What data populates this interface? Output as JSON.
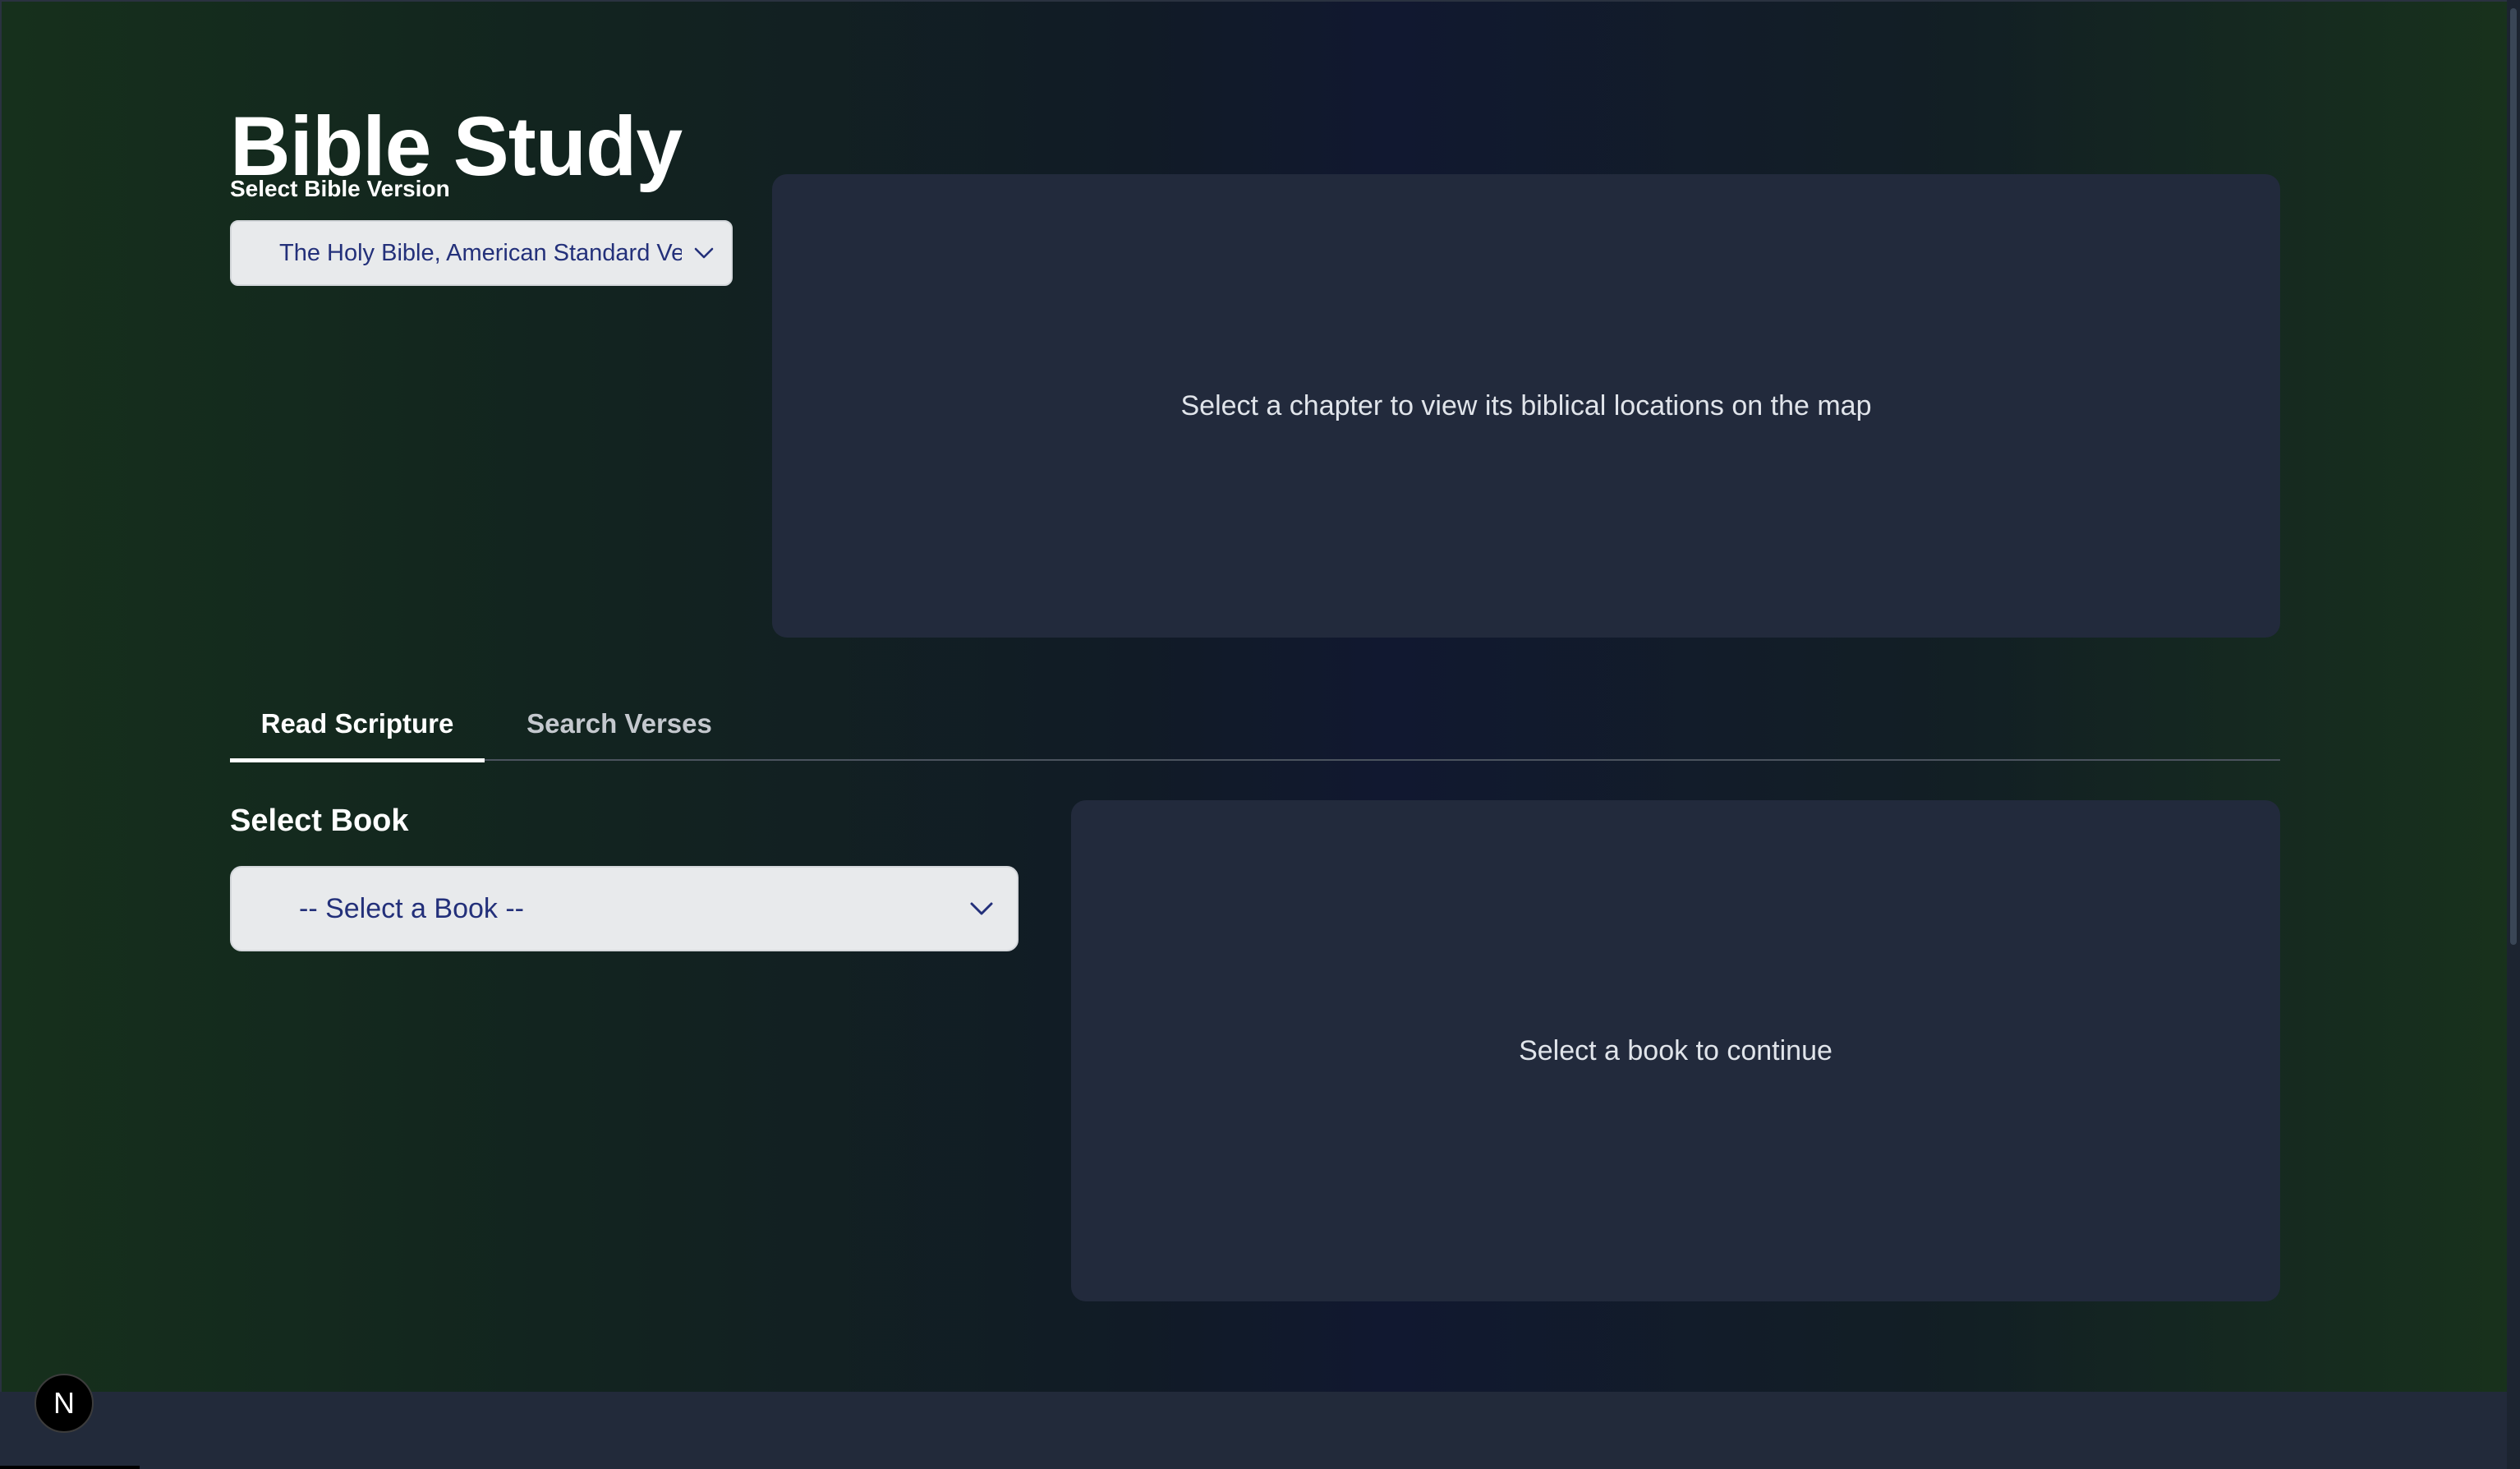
{
  "header": {
    "title": "Bible Study"
  },
  "version": {
    "label": "Select Bible Version",
    "selected": "The Holy Bible, American Standard Version"
  },
  "map_panel": {
    "message": "Select a chapter to view its biblical locations on the map"
  },
  "tabs": [
    {
      "label": "Read Scripture",
      "active": true
    },
    {
      "label": "Search Verses",
      "active": false
    }
  ],
  "book": {
    "label": "Select Book",
    "placeholder": "-- Select a Book --"
  },
  "content_panel": {
    "message": "Select a book to continue"
  },
  "devtools": {
    "badge_letter": "N"
  },
  "colors": {
    "accent_text": "#23307a",
    "panel": "#222a3c",
    "bg_edge_green": "#18321c"
  }
}
